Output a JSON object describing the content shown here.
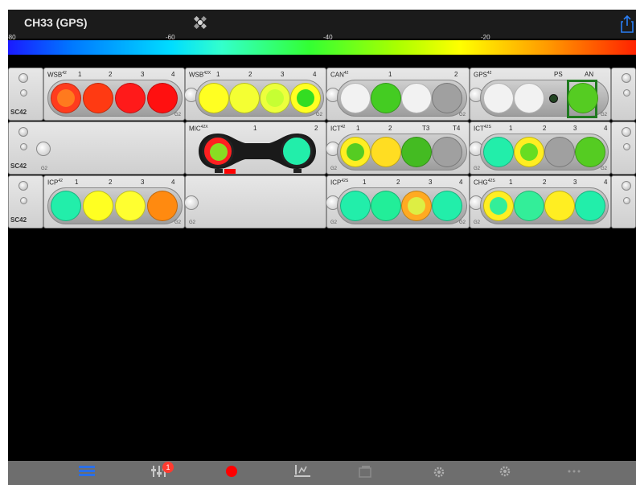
{
  "header": {
    "title": "CH33 (GPS)"
  },
  "scale": {
    "labels": [
      "-80",
      "-60",
      "-40",
      "-20"
    ]
  },
  "rows": [
    {
      "modules": [
        {
          "name": "WSB",
          "sup": "42",
          "nums": [
            "1",
            "2",
            "3",
            "4"
          ]
        },
        {
          "name": "WSB",
          "sup": "42X",
          "nums": [
            "1",
            "2",
            "3",
            "4"
          ]
        },
        {
          "name": "CAN",
          "sup": "42",
          "nums": [
            "1",
            "2"
          ]
        },
        {
          "name": "GPS",
          "sup": "42",
          "nums": [
            "PS",
            "AN"
          ]
        }
      ]
    },
    {
      "modules": [
        {
          "name": "MIC",
          "sup": "42X",
          "nums": [
            "1",
            "2"
          ]
        },
        {
          "name": "ICT",
          "sup": "42",
          "nums": [
            "1",
            "2",
            "T3",
            "T4"
          ]
        },
        {
          "name": "ICT",
          "sup": "42S",
          "nums": [
            "1",
            "2",
            "3",
            "4"
          ]
        }
      ]
    },
    {
      "modules": [
        {
          "name": "ICP",
          "sup": "42",
          "nums": [
            "1",
            "2",
            "3",
            "4"
          ]
        },
        {
          "name": "ICP",
          "sup": "42S",
          "nums": [
            "1",
            "2",
            "3",
            "4"
          ]
        },
        {
          "name": "CHG",
          "sup": "42S",
          "nums": [
            "1",
            "2",
            "3",
            "4"
          ]
        }
      ]
    }
  ],
  "labels": {
    "sc": "SC42",
    "g2": "G2"
  },
  "badge": {
    "count": "1"
  },
  "colors": {
    "selected_outline": "#1f7a1f",
    "badge": "#ff3b30",
    "record": "#ff0000",
    "active_tab": "#2a6fe8"
  },
  "tabs": [
    {
      "icon": "list-icon"
    },
    {
      "icon": "mixer-icon"
    },
    {
      "icon": "record-icon"
    },
    {
      "icon": "channels-icon"
    },
    {
      "icon": "scenes-icon"
    },
    {
      "icon": "settings-icon"
    },
    {
      "icon": "more-settings-icon"
    },
    {
      "icon": "more-icon"
    }
  ]
}
